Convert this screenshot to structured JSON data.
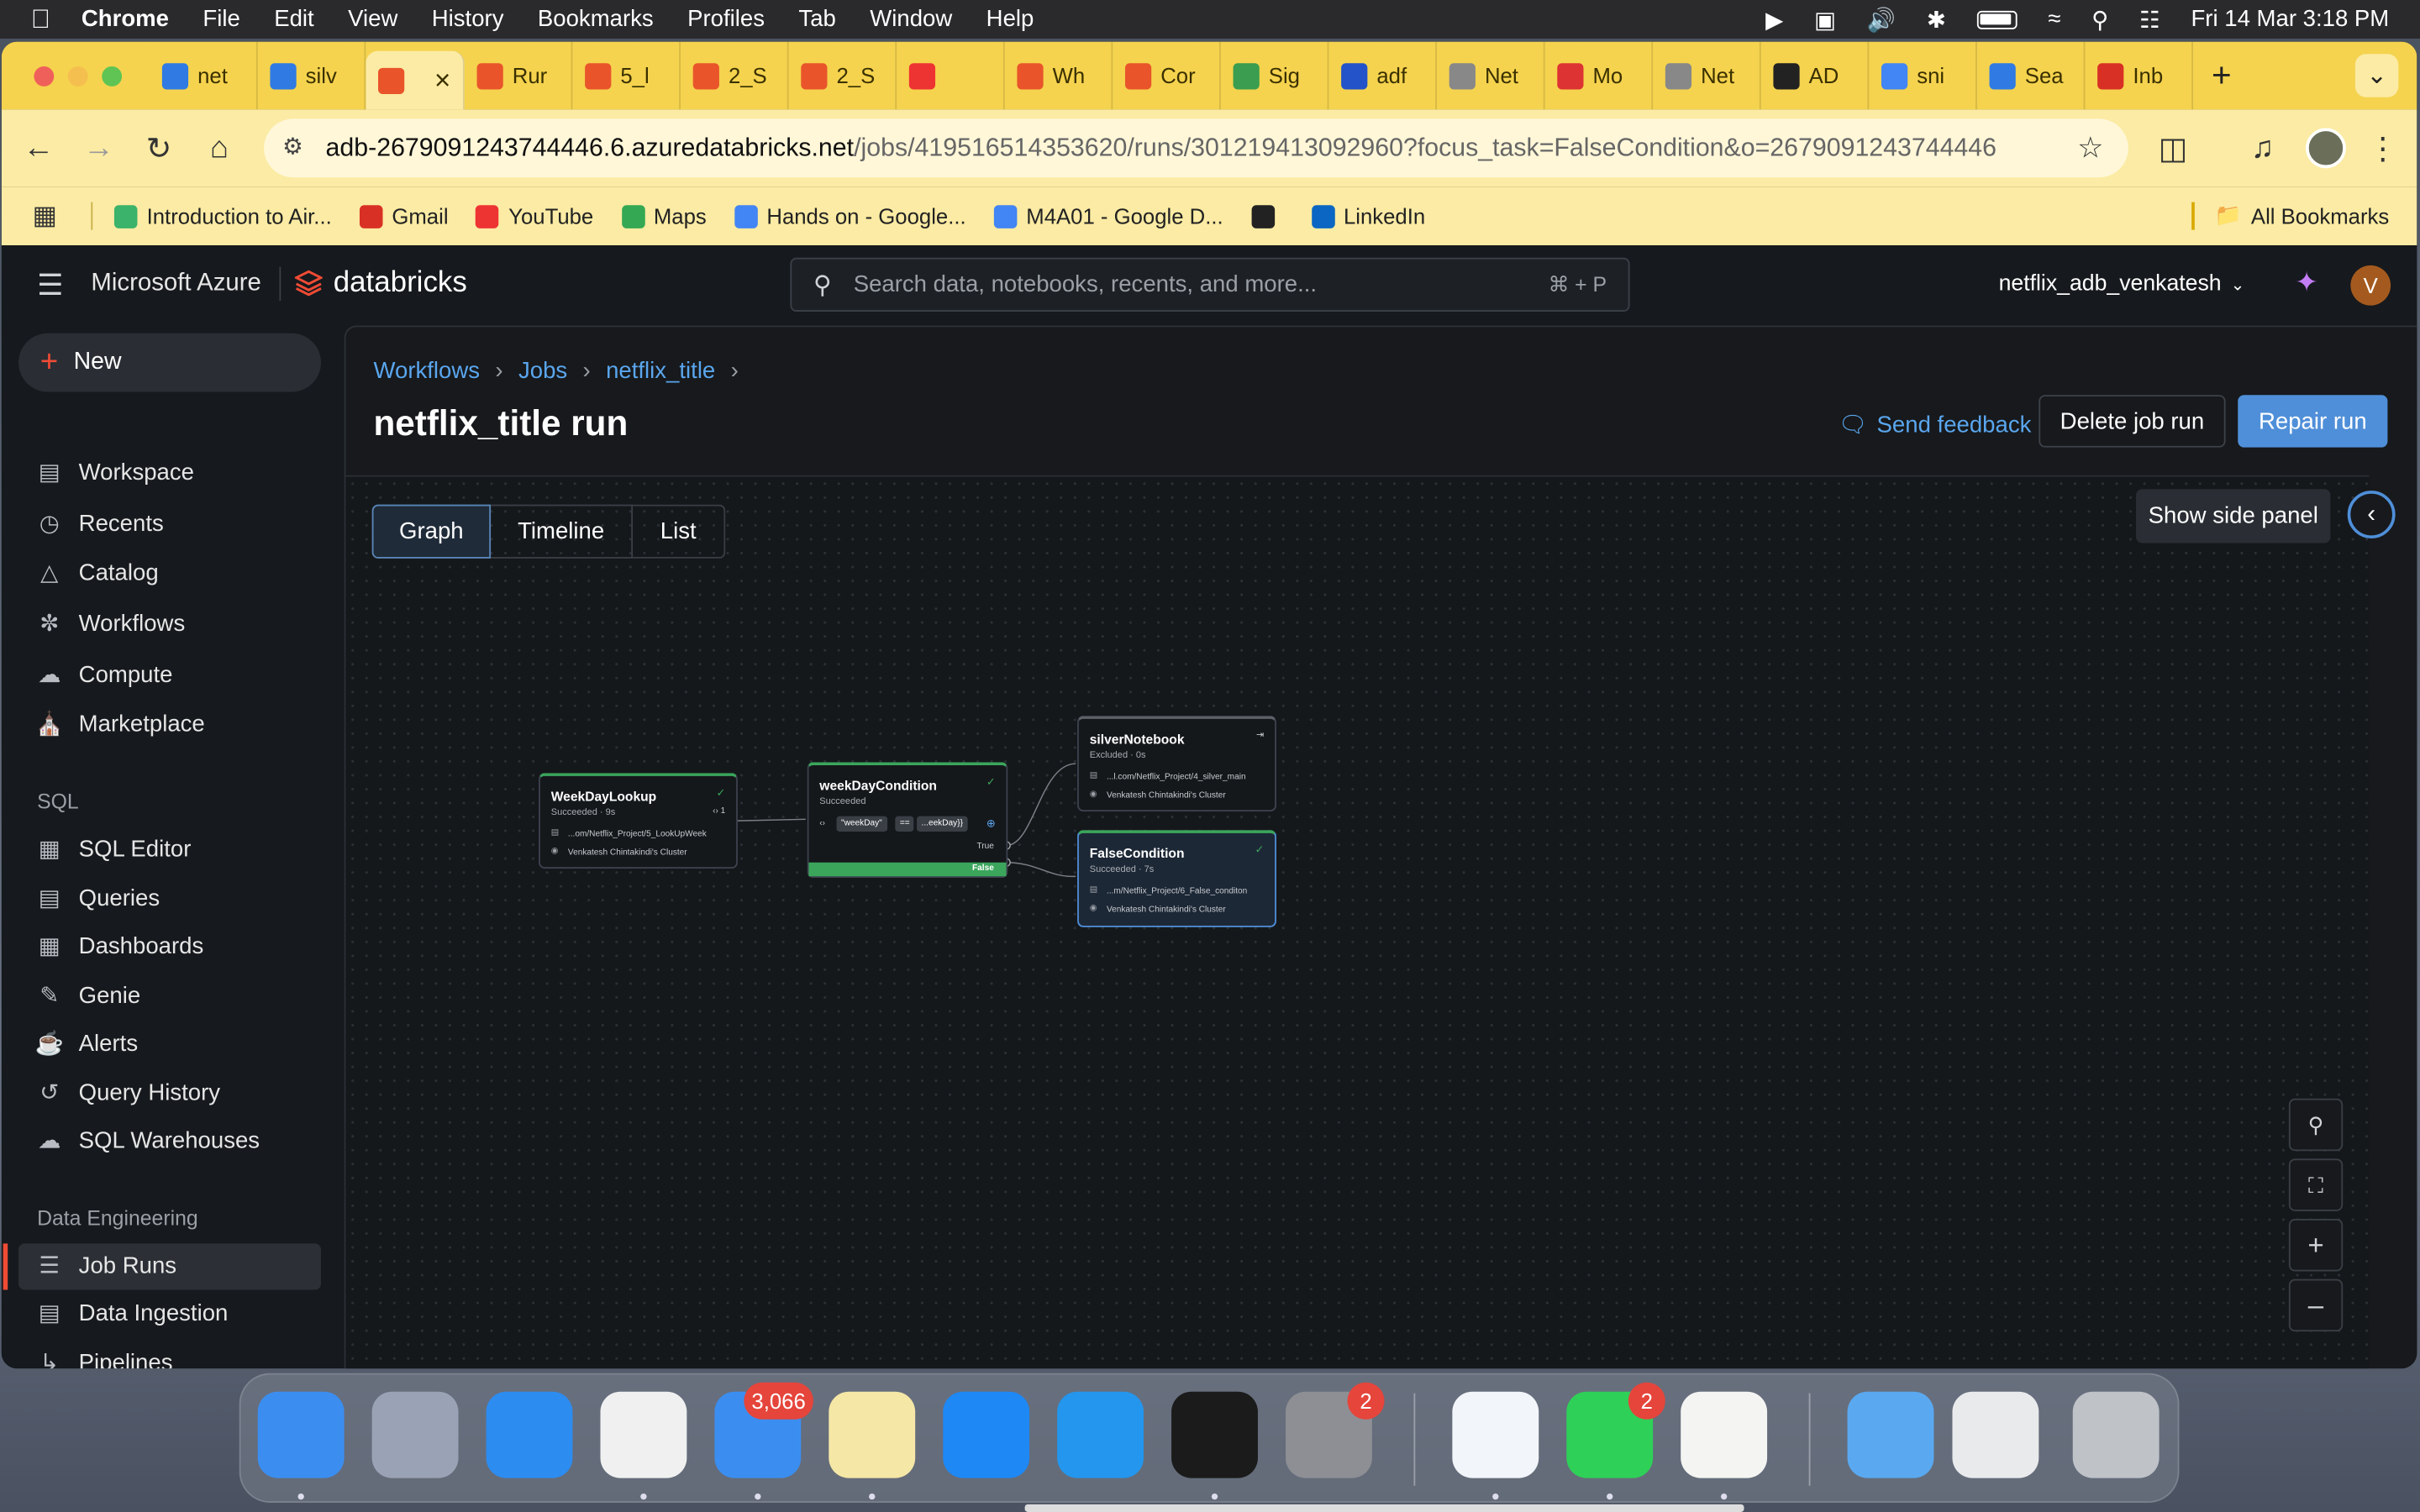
{
  "menubar": {
    "app": "Chrome",
    "items": [
      "File",
      "Edit",
      "View",
      "History",
      "Bookmarks",
      "Profiles",
      "Tab",
      "Window",
      "Help"
    ],
    "clock": "Fri 14 Mar  3:18 PM"
  },
  "tabs": [
    {
      "label": "net",
      "color": "#2f7be3"
    },
    {
      "label": "silv",
      "color": "#2f7be3"
    },
    {
      "label": "",
      "color": "#e9542b",
      "active": true
    },
    {
      "label": "Rur",
      "color": "#e9542b"
    },
    {
      "label": "5_l",
      "color": "#e9542b"
    },
    {
      "label": "2_S",
      "color": "#e9542b"
    },
    {
      "label": "2_S",
      "color": "#e9542b"
    },
    {
      "label": "",
      "color": "#e33"
    },
    {
      "label": "Wh",
      "color": "#e9542b"
    },
    {
      "label": "Cor",
      "color": "#e9542b"
    },
    {
      "label": "Sig",
      "color": "#3a9d4f"
    },
    {
      "label": "adf",
      "color": "#2453c9"
    },
    {
      "label": "Net",
      "color": "#888"
    },
    {
      "label": "Mo",
      "color": "#d33"
    },
    {
      "label": "Net",
      "color": "#888"
    },
    {
      "label": "AD",
      "color": "#222"
    },
    {
      "label": "sni",
      "color": "#4285f4"
    },
    {
      "label": "Sea",
      "color": "#2f7be3"
    },
    {
      "label": "Inb",
      "color": "#d93025"
    }
  ],
  "url": "adb-2679091243744446.6.azuredatabricks.net/jobs/419516514353620/runs/301219413092960?focus_task=FalseCondition&o=2679091243744446",
  "url_host": "adb-2679091243744446.6.azuredatabricks.net",
  "url_path": "/jobs/419516514353620/runs/301219413092960?focus_task=FalseCondition&o=2679091243744446",
  "bookmarks": [
    {
      "label": "Introduction to Air...",
      "color": "#3bb36a"
    },
    {
      "label": "Gmail",
      "color": "#d93025"
    },
    {
      "label": "YouTube",
      "color": "#e33"
    },
    {
      "label": "Maps",
      "color": "#34a853"
    },
    {
      "label": "Hands on - Google...",
      "color": "#4285f4"
    },
    {
      "label": "M4A01 - Google D...",
      "color": "#4285f4"
    },
    {
      "label": "",
      "color": "#222"
    },
    {
      "label": "LinkedIn",
      "color": "#0a66c2"
    }
  ],
  "all_bookmarks": "All Bookmarks",
  "brand": {
    "azure": "Microsoft Azure",
    "product": "databricks"
  },
  "search": {
    "placeholder": "Search data, notebooks, recents, and more...",
    "shortcut": "⌘ + P"
  },
  "workspace_name": "netflix_adb_venkatesh",
  "avatar_letter": "V",
  "sidebar": {
    "new_label": "New",
    "items": [
      "Workspace",
      "Recents",
      "Catalog",
      "Workflows",
      "Compute",
      "Marketplace"
    ],
    "sql_header": "SQL",
    "sql_items": [
      "SQL Editor",
      "Queries",
      "Dashboards",
      "Genie",
      "Alerts",
      "Query History",
      "SQL Warehouses"
    ],
    "de_header": "Data Engineering",
    "de_items": [
      "Job Runs",
      "Data Ingestion",
      "Pipelines"
    ]
  },
  "breadcrumb": [
    "Workflows",
    "Jobs",
    "netflix_title"
  ],
  "page_title": "netflix_title run",
  "actions": {
    "feedback": "Send feedback",
    "delete": "Delete job run",
    "repair": "Repair run"
  },
  "view_tabs": [
    "Graph",
    "Timeline",
    "List"
  ],
  "side_panel_tooltip": "Show side panel",
  "graph": {
    "nodes": [
      {
        "name": "WeekDayLookup",
        "status": "Succeeded · 9s",
        "path": "...om/Netflix_Project/5_LookUpWeek",
        "cluster": "Venkatesh Chintakindi's Cluster",
        "badge": "‹› 1"
      },
      {
        "name": "weekDayCondition",
        "status": "Succeeded",
        "expr_left": "\"weekDay\"",
        "expr_op": "==",
        "expr_right": "...eekDay}}",
        "true_label": "True",
        "false_label": "False"
      },
      {
        "name": "silverNotebook",
        "status": "Excluded · 0s",
        "path": "...l.com/Netflix_Project/4_silver_main",
        "cluster": "Venkatesh Chintakindi's Cluster"
      },
      {
        "name": "FalseCondition",
        "status": "Succeeded · 7s",
        "path": "...m/Netflix_Project/6_False_conditon",
        "cluster": "Venkatesh Chintakindi's Cluster"
      }
    ]
  },
  "dock": [
    {
      "name": "Finder",
      "color": "#3b8ef0"
    },
    {
      "name": "Launchpad",
      "color": "#9aa3b5"
    },
    {
      "name": "Safari",
      "color": "#2d8cf0"
    },
    {
      "name": "Chrome",
      "color": "#f0f0f0"
    },
    {
      "name": "Mail",
      "color": "#3b8ef0",
      "badge": "3,066"
    },
    {
      "name": "Notes",
      "color": "#f5e7a6"
    },
    {
      "name": "App Store",
      "color": "#1e88f5"
    },
    {
      "name": "Docker",
      "color": "#2496ed"
    },
    {
      "name": "Terminal",
      "color": "#1b1b1b"
    },
    {
      "name": "System Settings",
      "color": "#8d8f94",
      "badge": "2"
    },
    {
      "name": "VS Code",
      "color": "#f2f5f9"
    },
    {
      "name": "WhatsApp",
      "color": "#2fd058",
      "badge": "2"
    },
    {
      "name": "TextEdit",
      "color": "#f4f4f2"
    },
    {
      "name": "Files",
      "color": "#5aa9f0"
    },
    {
      "name": "Preview",
      "color": "#e9eaec"
    },
    {
      "name": "Trash",
      "color": "#bfc3c8"
    }
  ],
  "colors": {
    "tabstrip": "#f5d34e",
    "accent": "#5aa6ee",
    "success": "#3ba55c",
    "repair": "#4f8fd9"
  }
}
